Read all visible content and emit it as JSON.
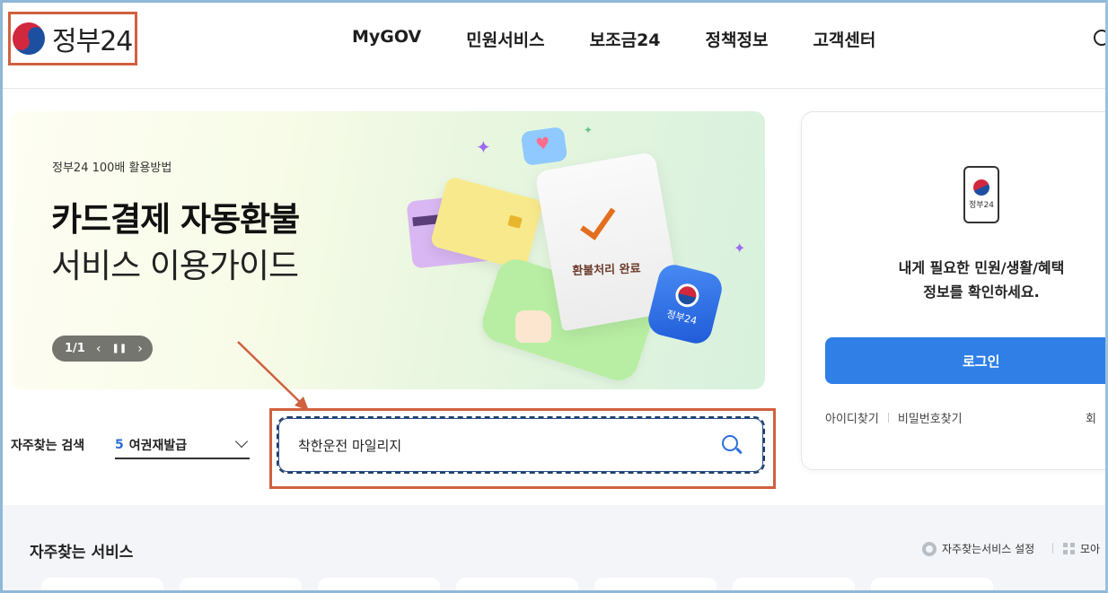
{
  "header": {
    "logo_text": "정부24",
    "nav": [
      "MyGOV",
      "민원서비스",
      "보조금24",
      "정책정보",
      "고객센터"
    ]
  },
  "banner": {
    "kicker": "정부24 100배 활용방법",
    "title": "카드결제 자동환불",
    "subtitle": "서비스 이용가이드",
    "pager": "1/1",
    "receipt_text": "환불처리 완료",
    "badge_text": "정부24"
  },
  "search": {
    "freq_label": "자주찾는 검색",
    "freq_rank": "5",
    "freq_value": "여권재발급",
    "query": "착한운전 마일리지"
  },
  "login": {
    "icon_text": "정부24",
    "message_line1": "내게 필요한 민원/생활/혜택",
    "message_line2": "정보를 확인하세요.",
    "button": "로그인",
    "find_id": "아이디찾기",
    "find_pw": "비밀번호찾기",
    "right_link": "회"
  },
  "services": {
    "title": "자주찾는 서비스",
    "setting": "자주찾는서비스 설정",
    "collect": "모아"
  },
  "colors": {
    "accent": "#2f7fe6",
    "annotation": "#d0603f"
  }
}
